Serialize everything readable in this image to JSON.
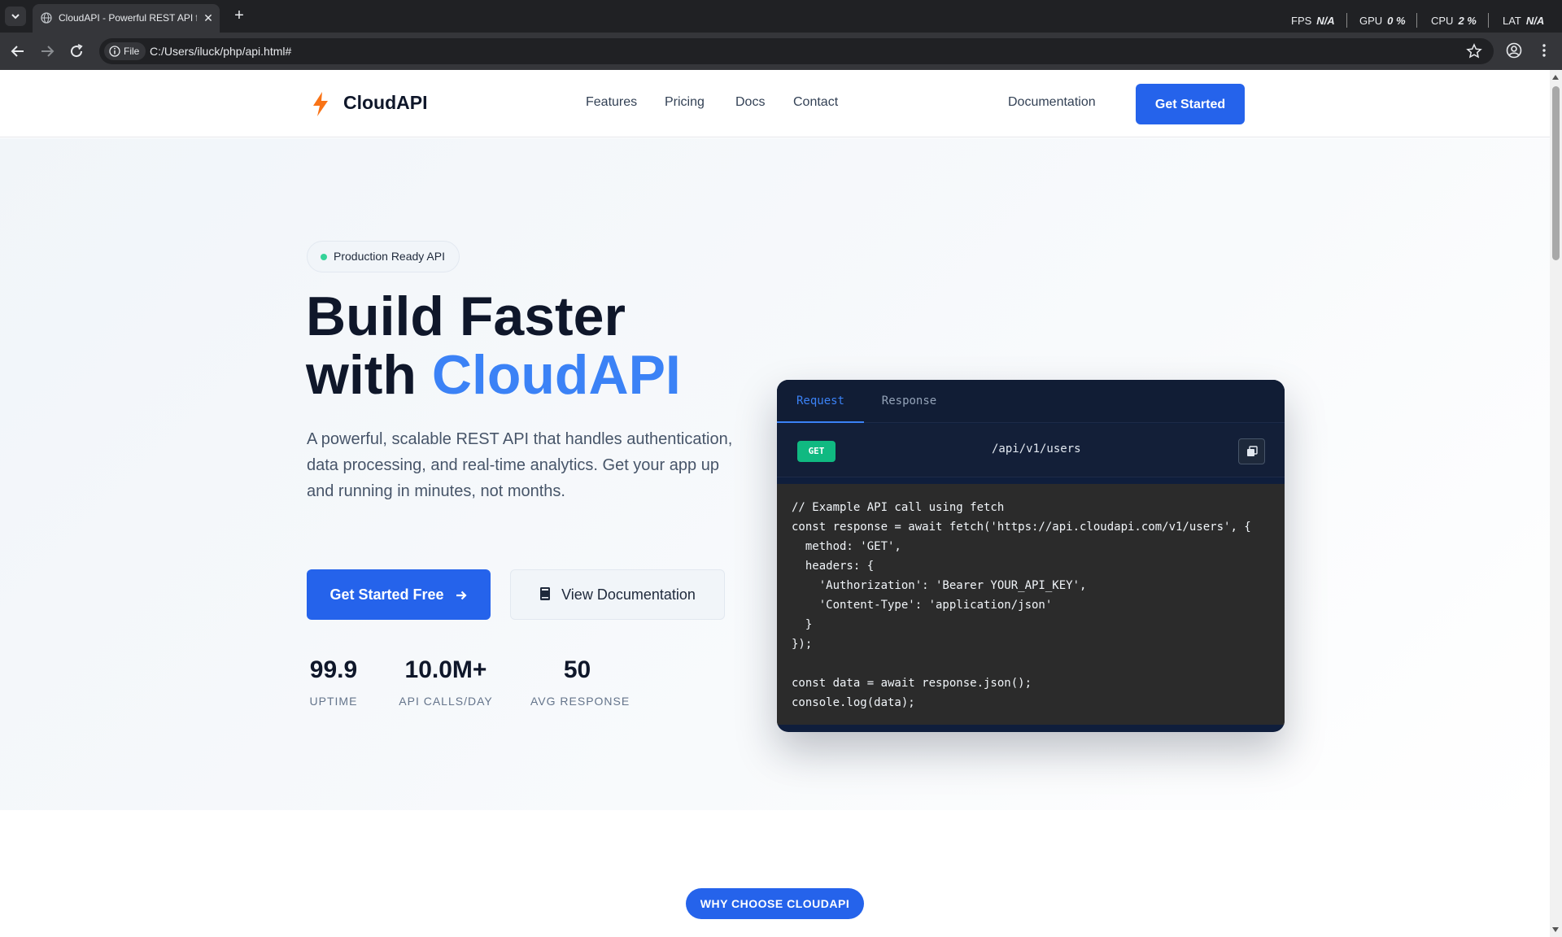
{
  "browser": {
    "tab_title": "CloudAPI - Powerful REST API f",
    "new_tab_label": "+",
    "close_label": "✕",
    "address_chip": "File",
    "address": "C:/Users/iluck/php/api.html#",
    "perf": [
      {
        "label": "FPS",
        "value": "N/A"
      },
      {
        "label": "GPU",
        "value": "0 %"
      },
      {
        "label": "CPU",
        "value": "2 %"
      },
      {
        "label": "LAT",
        "value": "N/A"
      }
    ]
  },
  "header": {
    "logo": "CloudAPI",
    "nav": [
      "Features",
      "Pricing",
      "Docs",
      "Contact"
    ],
    "documentation": "Documentation",
    "cta": "Get Started"
  },
  "hero": {
    "badge": "Production Ready API",
    "title_line1": "Build Faster",
    "title_line2_prefix": "with ",
    "title_accent": "CloudAPI",
    "subtitle": "A powerful, scalable REST API that handles authentication, data processing, and real-time analytics. Get your app up and running in minutes, not months.",
    "primary_button": "Get Started Free",
    "secondary_button": "View Documentation",
    "stats": [
      {
        "value": "99.9",
        "label": "UPTIME"
      },
      {
        "value": "10.0M+",
        "label": "API CALLS/DAY"
      },
      {
        "value": "50",
        "label": "AVG RESPONSE"
      }
    ]
  },
  "code_card": {
    "tabs": [
      "Request",
      "Response"
    ],
    "method": "GET",
    "endpoint": "/api/v1/users",
    "lines": [
      "// Example API call using fetch",
      "const response = await fetch('https://api.cloudapi.com/v1/users', {",
      "  method: 'GET',",
      "  headers: {",
      "    'Authorization': 'Bearer YOUR_API_KEY',",
      "    'Content-Type': 'application/json'",
      "  }",
      "});",
      "",
      "const data = await response.json();",
      "console.log(data);"
    ]
  },
  "section": {
    "pill": "WHY CHOOSE CLOUDAPI"
  },
  "colors": {
    "primary": "#2563eb",
    "accent": "#3b82f6",
    "success": "#10b981",
    "code_bg": "#2b2b2b",
    "card_bg": "#0f1e3c"
  }
}
